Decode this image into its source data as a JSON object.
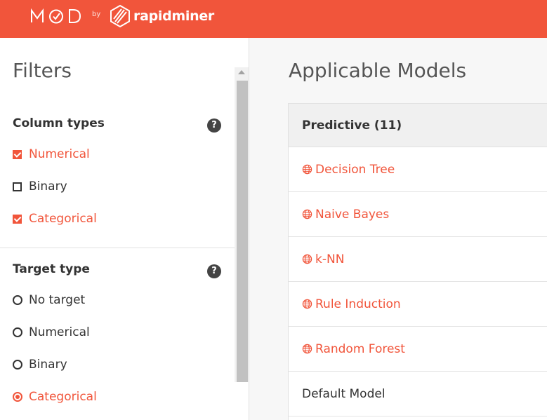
{
  "header": {
    "logo_text": "MOD",
    "by_text": "by",
    "brand_text": "rapidminer",
    "accent": "#f1553b"
  },
  "filters": {
    "title": "Filters",
    "column_types": {
      "title": "Column types",
      "help_icon": "question-circle-icon",
      "help_glyph": "?",
      "options": [
        {
          "label": "Numerical",
          "checked": true
        },
        {
          "label": "Binary",
          "checked": false
        },
        {
          "label": "Categorical",
          "checked": true
        }
      ]
    },
    "target_type": {
      "title": "Target type",
      "help_icon": "question-circle-icon",
      "help_glyph": "?",
      "options": [
        {
          "label": "No target",
          "selected": false
        },
        {
          "label": "Numerical",
          "selected": false
        },
        {
          "label": "Binary",
          "selected": false
        },
        {
          "label": "Categorical",
          "selected": true
        }
      ]
    }
  },
  "main": {
    "title": "Applicable Models",
    "group_header": "Predictive (11)",
    "models": [
      {
        "label": "Decision Tree",
        "icon": "globe-icon",
        "link": true
      },
      {
        "label": "Naive Bayes",
        "icon": "globe-icon",
        "link": true
      },
      {
        "label": "k-NN",
        "icon": "globe-icon",
        "link": true
      },
      {
        "label": "Rule Induction",
        "icon": "globe-icon",
        "link": true
      },
      {
        "label": "Random Forest",
        "icon": "globe-icon",
        "link": true
      },
      {
        "label": "Default Model",
        "icon": "",
        "link": false
      }
    ]
  }
}
